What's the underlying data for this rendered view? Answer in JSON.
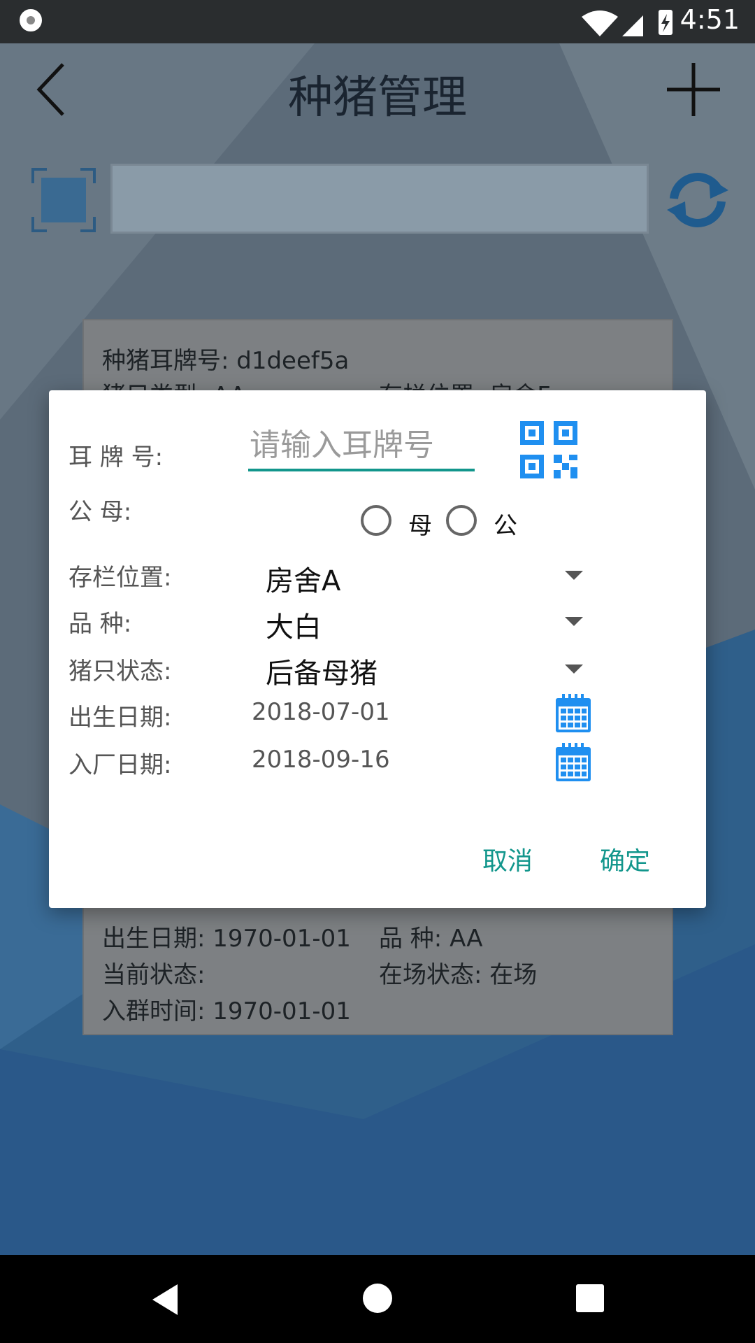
{
  "status_bar": {
    "time": "4:51"
  },
  "app_bar": {
    "title": "种猪管理"
  },
  "background_card": {
    "ear_tag_line": "种猪耳牌号: d1deef5a",
    "pig_type_partial": "猪只类型: AA",
    "pen_location_partial": "存栏位置: 房舍F",
    "birth_date": "出生日期: 1970-01-01",
    "breed": "品         种: AA",
    "current_status": "当前状态:",
    "on_site_status": "在场状态: 在场",
    "join_time": "入群时间: 1970-01-01"
  },
  "dialog": {
    "ear_tag_label": "耳  牌  号:",
    "ear_tag_placeholder": "请输入耳牌号",
    "sex_label": "公        母:",
    "sex_female": "母",
    "sex_male": "公",
    "pen_label": "存栏位置:",
    "pen_value": "房舍A",
    "breed_label": "品        种:",
    "breed_value": "大白",
    "status_label": "猪只状态:",
    "status_value": "后备母猪",
    "birth_label": "出生日期:",
    "birth_value": "2018-07-01",
    "entry_label": "入厂日期:",
    "entry_value": "2018-09-16",
    "cancel": "取消",
    "confirm": "确定"
  },
  "colors": {
    "accent": "#12968c",
    "icon_blue": "#1f8ff0",
    "status_bar": "#2a2d2f"
  }
}
